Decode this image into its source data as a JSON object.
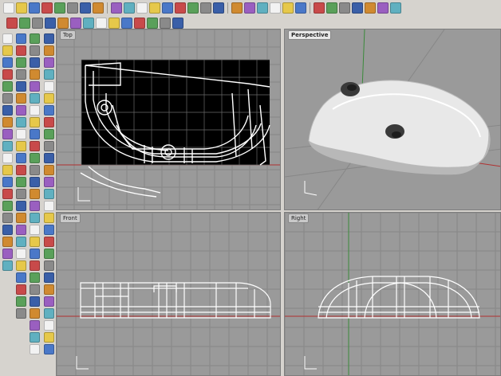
{
  "toolbar_top": {
    "row1_icons": [
      "new-file-icon",
      "open-icon",
      "save-icon",
      "print-icon",
      "cut-icon",
      "copy-icon",
      "paste-icon",
      "undo-icon",
      "select-icon",
      "pan-icon",
      "rotate-view-icon",
      "zoom-icon",
      "zoom-window-icon",
      "zoom-extents-icon",
      "zoom-selected-icon",
      "four-views-icon",
      "grid-icon",
      "layer-icon",
      "color-icon",
      "properties-icon",
      "lightbulb-icon",
      "shade-icon",
      "render-icon",
      "sphere-icon",
      "rendered-sphere-icon",
      "ghost-sphere-icon",
      "blue-sphere-icon",
      "tools-icon",
      "gear-icon",
      "help-icon"
    ],
    "row2_icons": [
      "curve-icon",
      "polyline-icon",
      "ortho-icon",
      "snap-icon",
      "planar-icon",
      "osnap-icon",
      "record-history-icon",
      "gumball-icon",
      "move-icon",
      "rotate-icon",
      "scale-icon",
      "mirror-icon",
      "check-icon",
      "analyze-icon"
    ]
  },
  "viewports": {
    "top": {
      "label": "Top"
    },
    "perspective": {
      "label": "Perspective"
    },
    "front": {
      "label": "Front"
    },
    "right": {
      "label": "Right"
    }
  },
  "colors": {
    "viewport_bg": "#9a9a9a",
    "grid": "#878787",
    "axis_x": "#b03030",
    "axis_y": "#3a8a3a",
    "selection_bg": "#000000",
    "wire": "#ffffff"
  }
}
